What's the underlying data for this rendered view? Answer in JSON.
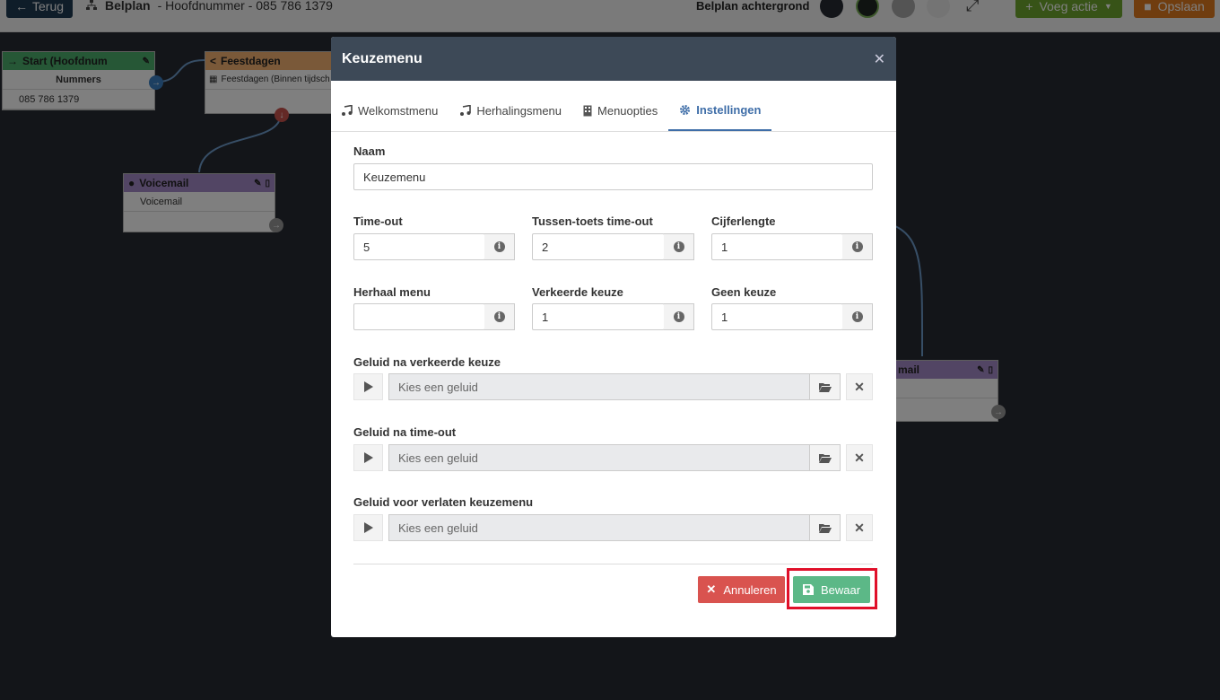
{
  "topbar": {
    "back_label": "Terug",
    "plan_name": "Belplan",
    "plan_subtitle": "- Hoofdnummer - 085 786 1379",
    "background_label": "Belplan achtergrond",
    "swatch_colors": [
      "#262a33",
      "#1f2722",
      "#a9a9a9",
      "#e9e9e9"
    ],
    "add_action_label": "Voeg actie",
    "save_label": "Opslaan"
  },
  "canvas": {
    "start_node": {
      "title": "Start (Hoofdnum",
      "header_row": "Nummers",
      "number": "085 786 1379",
      "color": "#4cae6c"
    },
    "holidays_node": {
      "title": "Feestdagen",
      "row": "Feestdagen (Binnen tijdsch",
      "color": "#f4b272"
    },
    "voicemail_node": {
      "title": "Voicemail",
      "row": "Voicemail",
      "color": "#a58ac8"
    },
    "voicemail2_node": {
      "title_partial": "mail",
      "color": "#a58ac8"
    }
  },
  "modal": {
    "title": "Keuzemenu",
    "close_icon": "close-icon",
    "tabs": [
      {
        "label": "Welkomstmenu",
        "icon": "music-icon",
        "active": false
      },
      {
        "label": "Herhalingsmenu",
        "icon": "music-icon",
        "active": false
      },
      {
        "label": "Menuopties",
        "icon": "building-icon",
        "active": false
      },
      {
        "label": "Instellingen",
        "icon": "gear-icon",
        "active": true
      }
    ],
    "fields": {
      "name_label": "Naam",
      "name_value": "Keuzemenu",
      "timeout_label": "Time-out",
      "timeout_value": "5",
      "inter_key_label": "Tussen-toets time-out",
      "inter_key_value": "2",
      "digit_length_label": "Cijferlengte",
      "digit_length_value": "1",
      "repeat_label": "Herhaal menu",
      "repeat_value": "",
      "wrong_choice_label": "Verkeerde keuze",
      "wrong_choice_value": "1",
      "no_choice_label": "Geen keuze",
      "no_choice_value": "1"
    },
    "sounds": [
      {
        "label": "Geluid na verkeerde keuze",
        "placeholder": "Kies een geluid"
      },
      {
        "label": "Geluid na time-out",
        "placeholder": "Kies een geluid"
      },
      {
        "label": "Geluid voor verlaten keuzemenu",
        "placeholder": "Kies een geluid"
      }
    ],
    "cancel_label": "Annuleren",
    "save_label": "Bewaar",
    "accent_color": "#3f6ea8",
    "highlight_color": "#e0102a"
  }
}
